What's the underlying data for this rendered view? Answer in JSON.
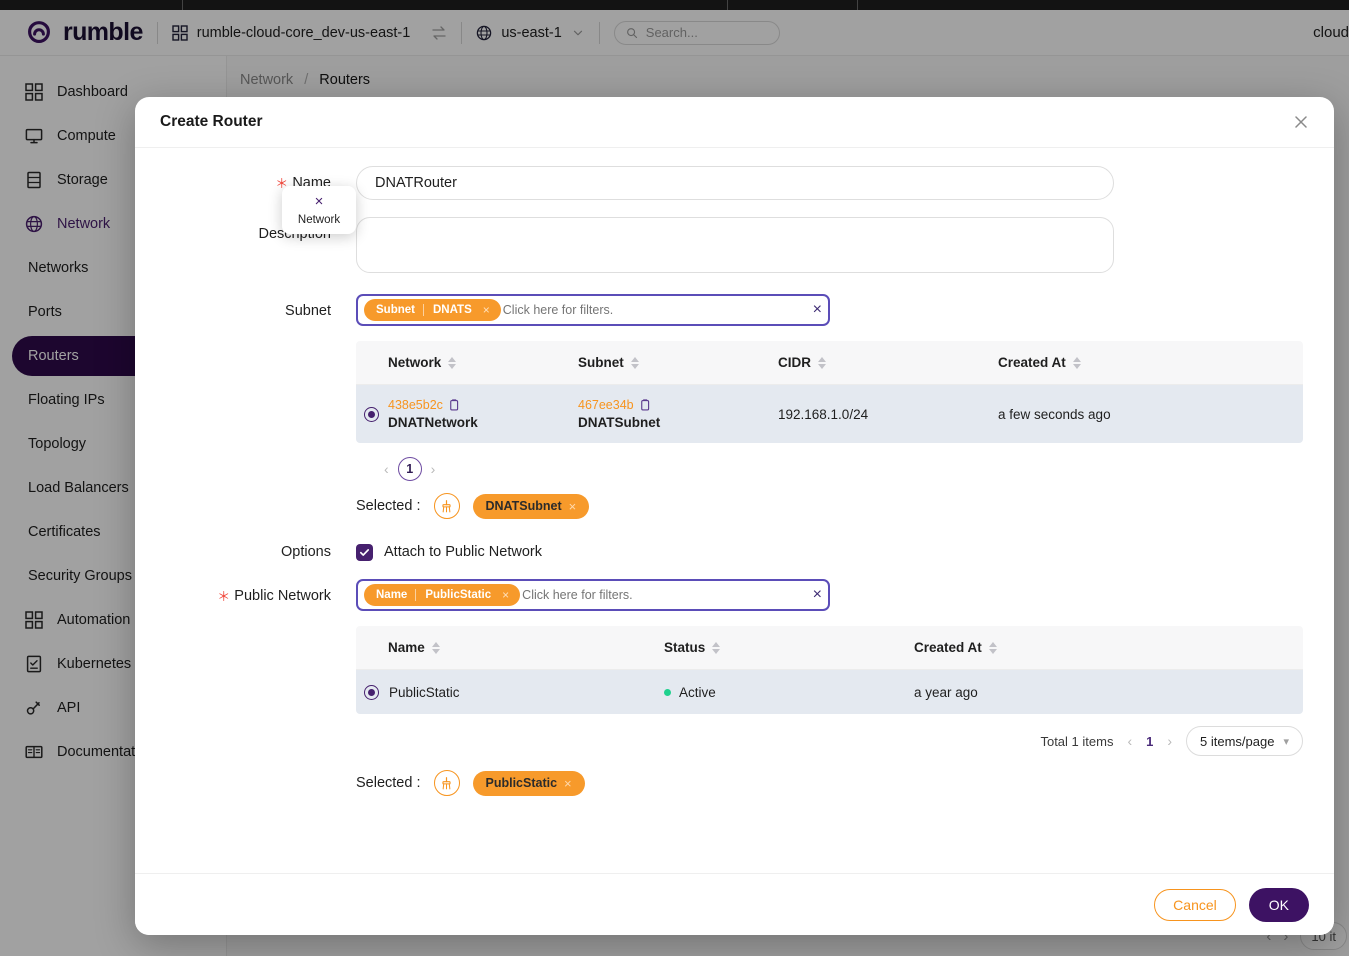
{
  "topbar": {
    "brand": "rumble",
    "project": "rumble-cloud-core_dev-us-east-1",
    "region": "us-east-1",
    "search_placeholder": "Search...",
    "right_text": "cloud"
  },
  "sidebar": {
    "items": [
      {
        "label": "Dashboard",
        "icon": "grid-icon",
        "type": "top"
      },
      {
        "label": "Compute",
        "icon": "monitor-icon",
        "type": "top"
      },
      {
        "label": "Storage",
        "icon": "storage-icon",
        "type": "top"
      },
      {
        "label": "Network",
        "icon": "globe-icon",
        "type": "top",
        "active": true
      },
      {
        "label": "Networks",
        "icon": "",
        "type": "sub"
      },
      {
        "label": "Ports",
        "icon": "",
        "type": "sub"
      },
      {
        "label": "Routers",
        "icon": "",
        "type": "sub",
        "selected": true
      },
      {
        "label": "Floating IPs",
        "icon": "",
        "type": "sub"
      },
      {
        "label": "Topology",
        "icon": "",
        "type": "sub"
      },
      {
        "label": "Load Balancers",
        "icon": "",
        "type": "sub"
      },
      {
        "label": "Certificates",
        "icon": "",
        "type": "sub"
      },
      {
        "label": "Security Groups",
        "icon": "",
        "type": "sub"
      },
      {
        "label": "Automation",
        "icon": "grid-icon",
        "type": "top"
      },
      {
        "label": "Kubernetes",
        "icon": "kubernetes-icon",
        "type": "top"
      },
      {
        "label": "API",
        "icon": "api-icon",
        "type": "top"
      },
      {
        "label": "Documentation",
        "icon": "book-icon",
        "type": "top"
      }
    ]
  },
  "breadcrumb": {
    "parent": "Network",
    "separator": "/",
    "current": "Routers"
  },
  "background_pager": {
    "items_per_page": "10 it"
  },
  "modal": {
    "title": "Create Router",
    "close_icon": "close-icon",
    "name": {
      "label": "Name",
      "required": true,
      "value": "DNATRouter"
    },
    "description": {
      "label": "Description",
      "value": "",
      "placeholder": ""
    },
    "subnet": {
      "label": "Subnet",
      "filter": {
        "chip_key": "Subnet",
        "chip_value": "DNATS",
        "chip_remove": "×",
        "placeholder": "Click here for filters.",
        "clear": "×"
      },
      "popover": {
        "x": "×",
        "label": "Network"
      },
      "table": {
        "columns": [
          "Network",
          "Subnet",
          "CIDR",
          "Created At"
        ],
        "rows": [
          {
            "selected": true,
            "network_id": "438e5b2c",
            "network_name": "DNATNetwork",
            "subnet_id": "467ee34b",
            "subnet_name": "DNATSubnet",
            "cidr": "192.168.1.0/24",
            "created_at": "a few seconds ago"
          }
        ]
      },
      "pagination": {
        "prev": "‹",
        "page": "1",
        "next": "›"
      },
      "selected": {
        "label": "Selected :",
        "clear_icon": "broom-icon",
        "chips": [
          {
            "text": "DNATSubnet",
            "remove": "×"
          }
        ]
      }
    },
    "options": {
      "label": "Options",
      "checkbox_label": "Attach to Public Network",
      "checked": true
    },
    "public_network": {
      "label": "Public Network",
      "required": true,
      "filter": {
        "chip_key": "Name",
        "chip_value": "PublicStatic",
        "chip_remove": "×",
        "placeholder": "Click here for filters.",
        "clear": "×"
      },
      "table": {
        "columns": [
          "Name",
          "Status",
          "Created At"
        ],
        "rows": [
          {
            "selected": true,
            "name": "PublicStatic",
            "status": "Active",
            "created_at": "a year ago"
          }
        ]
      },
      "pagination": {
        "total": "Total 1 items",
        "prev": "‹",
        "page": "1",
        "next": "›",
        "items_per_page": "5 items/page"
      },
      "selected": {
        "label": "Selected :",
        "clear_icon": "broom-icon",
        "chips": [
          {
            "text": "PublicStatic",
            "remove": "×"
          }
        ]
      }
    },
    "footer": {
      "cancel": "Cancel",
      "ok": "OK"
    }
  },
  "colors": {
    "brand_purple": "#3d1263",
    "accent_orange": "#f7941e",
    "focus_border": "#5b4db8",
    "status_active": "#1fd18e",
    "required_red": "#f04438",
    "row_selected_bg": "#e4e9f0"
  }
}
